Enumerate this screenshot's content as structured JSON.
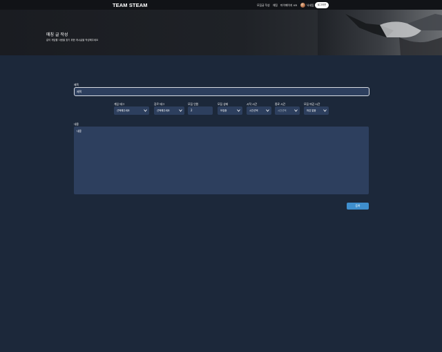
{
  "nav": {
    "brand": "TEAM STEAM",
    "links": [
      "모집글 작성",
      "채팅",
      "마이페이지",
      "KR"
    ],
    "nickname": "닉네임",
    "cta": "로그아웃"
  },
  "hero": {
    "title": "매칭 글 작성",
    "subtitle": "같이 게임할 사람을 찾기 위한 게시글을 작성해주세요"
  },
  "form": {
    "title_label": "제목",
    "title_value": "제목",
    "fields": [
      {
        "label": "게임 태그",
        "value": "선택해주세요"
      },
      {
        "label": "장르 태그",
        "value": "선택해주세요"
      },
      {
        "label": "모집 인원",
        "value": "2"
      },
      {
        "label": "모집 상태",
        "value": "모집중"
      },
      {
        "label": "시작 시간",
        "value": "시간선택"
      },
      {
        "label": "종료 시간",
        "value": "시간선택"
      },
      {
        "label": "모집 마감 시간",
        "value": "마감 없음"
      }
    ],
    "content_label": "내용",
    "content_value": "내용",
    "submit_label": "등록"
  },
  "colors": {
    "page_bg": "#1c283a",
    "field_bg": "#2d3f5e",
    "accent": "#3f8fce",
    "nav_bg": "#111317"
  }
}
